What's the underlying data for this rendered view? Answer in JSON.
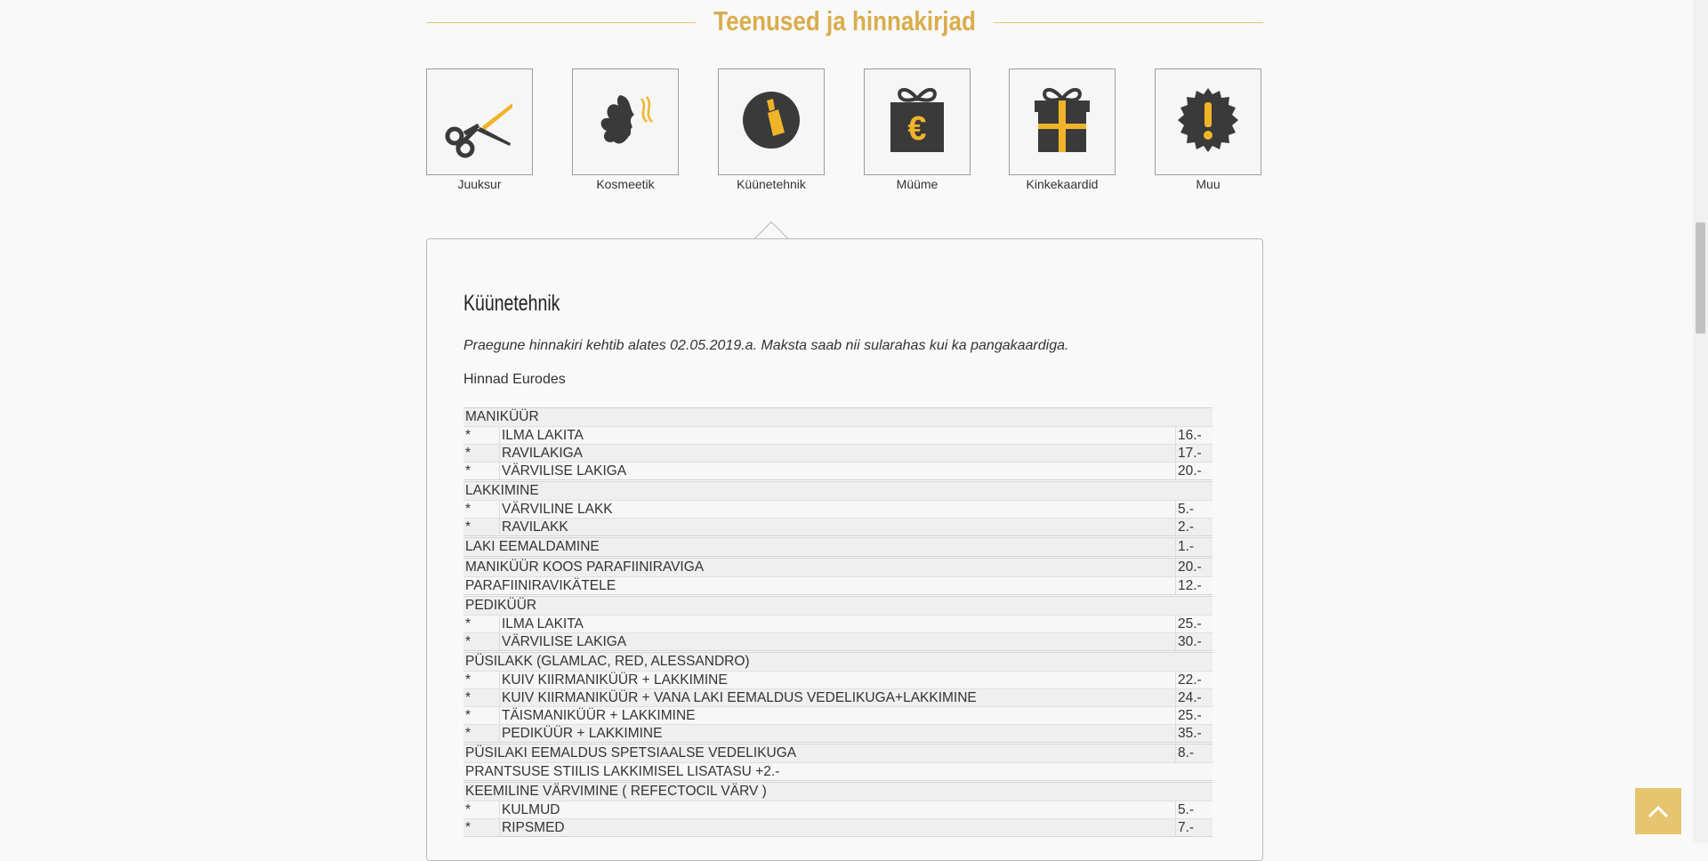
{
  "section": {
    "title": "Teenused ja hinnakirjad"
  },
  "tiles": [
    {
      "label": "Juuksur",
      "icon": "scissors-icon"
    },
    {
      "label": "Kosmeetik",
      "icon": "face-icon"
    },
    {
      "label": "Küünetehnik",
      "icon": "nail-polish-icon"
    },
    {
      "label": "Müüme",
      "icon": "euro-gift-icon"
    },
    {
      "label": "Kinkekaardid",
      "icon": "gift-icon"
    },
    {
      "label": "Muu",
      "icon": "exclamation-badge-icon"
    }
  ],
  "panel": {
    "heading": "Küünetehnik",
    "intro": "Praegune hinnakiri kehtib alates 02.05.2019.a. Maksta saab nii sularahas kui ka pangakaardiga.",
    "currency": "Hinnad Eurodes"
  },
  "price_groups": [
    {
      "title": "MANIKÜÜR",
      "price": "",
      "items": [
        {
          "mark": "*",
          "name": "ILMA LAKITA",
          "price": "16.-"
        },
        {
          "mark": "*",
          "name": "RAVILAKIGA",
          "price": "17.-"
        },
        {
          "mark": "*",
          "name": "VÄRVILISE LAKIGA",
          "price": "20.-"
        }
      ]
    },
    {
      "title": "LAKKIMINE",
      "price": "",
      "items": [
        {
          "mark": "*",
          "name": "VÄRVILINE LAKK",
          "price": "5.-"
        },
        {
          "mark": "*",
          "name": "RAVILAKK",
          "price": "2.-"
        }
      ]
    },
    {
      "title": "LAKI EEMALDAMINE",
      "price": "1.-",
      "items": []
    },
    {
      "title": "MANIKÜÜR KOOS PARAFIINIRAVIGA",
      "price": "20.-",
      "items": [
        {
          "mark": "PARAFIINIRAVIKÄTELE",
          "name": "",
          "price": "12.-",
          "full": true
        }
      ]
    },
    {
      "title": "PEDIKÜÜR",
      "price": "",
      "items": [
        {
          "mark": "*",
          "name": "ILMA LAKITA",
          "price": "25.-"
        },
        {
          "mark": "*",
          "name": "VÄRVILISE LAKIGA",
          "price": "30.-"
        }
      ]
    },
    {
      "title": "PÜSILAKK  (GLAMLAC, RED, ALESSANDRO)",
      "price": "",
      "items": [
        {
          "mark": "*",
          "name": "KUIV KIIRMANIKÜÜR + LAKKIMINE",
          "price": "22.-"
        },
        {
          "mark": "*",
          "name": "KUIV KIIRMANIKÜÜR + VANA LAKI EEMALDUS VEDELIKUGA+LAKKIMINE",
          "price": "24.-"
        },
        {
          "mark": "*",
          "name": "TÄISMANIKÜÜR  +  LAKKIMINE",
          "price": "25.-"
        },
        {
          "mark": "*",
          "name": "PEDIKÜÜR + LAKKIMINE",
          "price": "35.-"
        }
      ]
    },
    {
      "title": "PÜSILAKI EEMALDUS SPETSIAALSE VEDELIKUGA",
      "price": "8.-",
      "items": [
        {
          "mark": "PRANTSUSE STIILIS LAKKIMISEL LISATASU   +2.-",
          "name": "",
          "price": "",
          "full": true
        }
      ]
    },
    {
      "title": "KEEMILINE VÄRVIMINE  ( REFECTOCIL VÄRV )",
      "price": "",
      "items": [
        {
          "mark": "*",
          "name": "KULMUD",
          "price": "5.-"
        },
        {
          "mark": "*",
          "name": "RIPSMED",
          "price": "7.-"
        }
      ]
    }
  ],
  "colors": {
    "accent": "#d9ad4c",
    "icon_dark": "#3a3a3a",
    "icon_gold": "#f0b429"
  },
  "scroll_top": {
    "icon": "chevron-up-icon"
  }
}
